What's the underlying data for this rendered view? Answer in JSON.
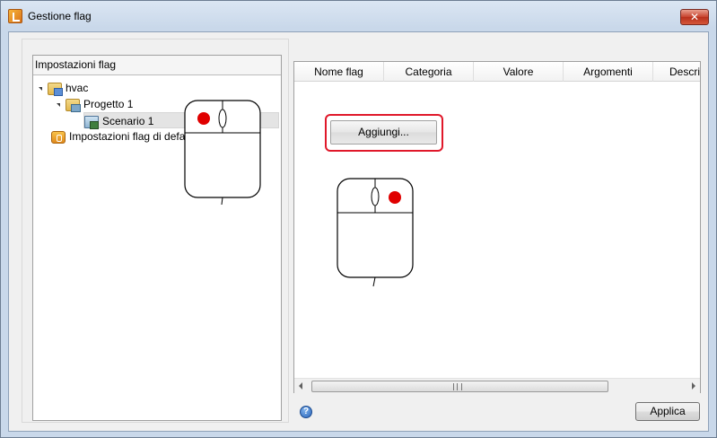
{
  "window": {
    "title": "Gestione flag",
    "close_glyph": "✕"
  },
  "tree": {
    "header": "Impostazioni flag",
    "items": [
      {
        "label": "hvac",
        "icon": "folder-icon"
      },
      {
        "label": "Progetto 1",
        "icon": "project-icon"
      },
      {
        "label": "Scenario 1",
        "icon": "scenario-icon",
        "selected": true
      },
      {
        "label": "Impostazioni flag di default",
        "icon": "defaults-icon"
      }
    ]
  },
  "grid": {
    "columns": [
      "Nome flag",
      "Categoria",
      "Valore",
      "Argomenti",
      "Descrizione"
    ],
    "rows": []
  },
  "actions": {
    "add_label": "Aggiungi...",
    "apply_label": "Applica",
    "help_glyph": "?"
  },
  "scrollbar": {
    "grip_glyph": "III"
  },
  "colors": {
    "highlight": "#e0182a",
    "mouse_click": "#e00000"
  }
}
